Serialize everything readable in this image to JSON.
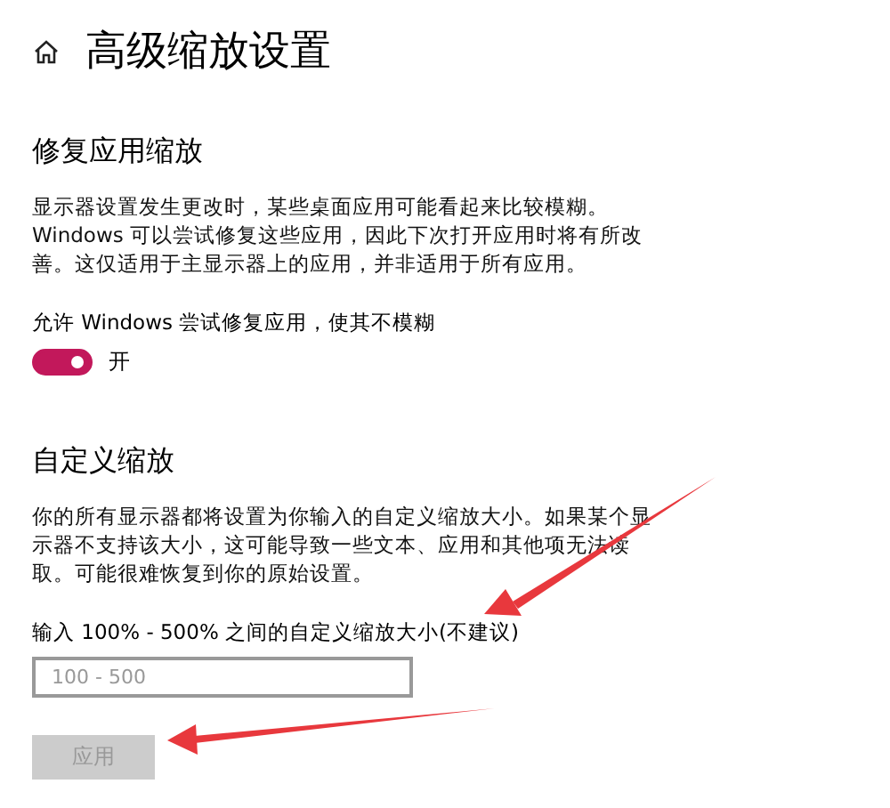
{
  "page": {
    "title": "高级缩放设置"
  },
  "fix_section": {
    "heading": "修复应用缩放",
    "description": "显示器设置发生更改时，某些桌面应用可能看起来比较模糊。Windows 可以尝试修复这些应用，因此下次打开应用时将有所改善。这仅适用于主显示器上的应用，并非适用于所有应用。",
    "toggle_label": "允许 Windows 尝试修复应用，使其不模糊",
    "toggle": {
      "on": true,
      "state_text": "开"
    }
  },
  "custom_section": {
    "heading": "自定义缩放",
    "description": "你的所有显示器都将设置为你输入的自定义缩放大小。如果某个显示器不支持该大小，这可能导致一些文本、应用和其他项无法读取。可能很难恢复到你的原始设置。",
    "field_label": "输入 100% - 500% 之间的自定义缩放大小(不建议)",
    "field": {
      "placeholder": "100 - 500"
    },
    "apply_button": {
      "label": "应用",
      "disabled": true
    }
  }
}
